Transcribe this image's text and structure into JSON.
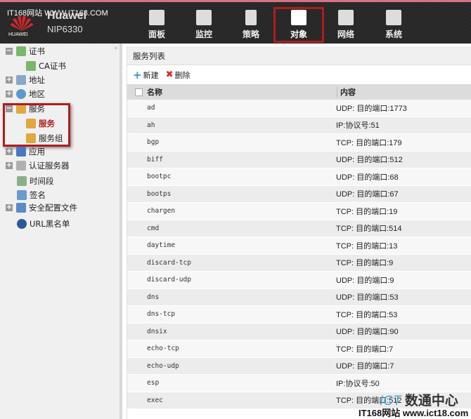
{
  "header": {
    "watermark": "IT168网站 WWW.IT168.COM",
    "logo_text": "HUAWEI",
    "brand": "Huawei",
    "model": "NIP6330",
    "nav": [
      {
        "label": "面板",
        "icon": "dashboard-icon"
      },
      {
        "label": "监控",
        "icon": "monitor-icon"
      },
      {
        "label": "策略",
        "icon": "policy-icon"
      },
      {
        "label": "对象",
        "icon": "object-icon",
        "selected": true
      },
      {
        "label": "网络",
        "icon": "network-icon"
      },
      {
        "label": "系统",
        "icon": "system-icon"
      }
    ],
    "accent": "#b01c1c"
  },
  "sidebar": {
    "items": [
      {
        "label": "证书",
        "expander": "−"
      },
      {
        "label": "CA证书"
      },
      {
        "label": "地址",
        "expander": "+"
      },
      {
        "label": "地区",
        "expander": "+"
      },
      {
        "label": "服务",
        "expander": "−"
      },
      {
        "label": "服务",
        "selected": true
      },
      {
        "label": "服务组"
      },
      {
        "label": "应用",
        "expander": "+"
      },
      {
        "label": "认证服务器",
        "expander": "+"
      },
      {
        "label": "时间段"
      },
      {
        "label": "签名"
      },
      {
        "label": "安全配置文件",
        "expander": "+"
      },
      {
        "label": "URL黑名单"
      }
    ]
  },
  "main": {
    "title": "服务列表",
    "toolbar": {
      "new": "新建",
      "delete": "删除"
    },
    "columns": [
      "名称",
      "内容"
    ],
    "rows": [
      [
        "ad",
        "UDP: 目的端口:1773"
      ],
      [
        "ah",
        "IP:协议号:51"
      ],
      [
        "bgp",
        "TCP: 目的端口:179"
      ],
      [
        "biff",
        "UDP: 目的端口:512"
      ],
      [
        "bootpc",
        "UDP: 目的端口:68"
      ],
      [
        "bootps",
        "UDP: 目的端口:67"
      ],
      [
        "chargen",
        "TCP: 目的端口:19"
      ],
      [
        "cmd",
        "TCP: 目的端口:514"
      ],
      [
        "daytime",
        "TCP: 目的端口:13"
      ],
      [
        "discard-tcp",
        "TCP: 目的端口:9"
      ],
      [
        "discard-udp",
        "UDP: 目的端口:9"
      ],
      [
        "dns",
        "UDP: 目的端口:53"
      ],
      [
        "dns-tcp",
        "TCP: 目的端口:53"
      ],
      [
        "dnsix",
        "UDP: 目的端口:90"
      ],
      [
        "echo-tcp",
        "TCP: 目的端口:7"
      ],
      [
        "echo-udp",
        "UDP: 目的端口:7"
      ],
      [
        "esp",
        "IP:协议号:50"
      ],
      [
        "exec",
        "TCP: 目的端口:512"
      ]
    ]
  },
  "watermarks": {
    "ict_prefix": "ICT",
    "ict_suffix": "数通中心",
    "site": "IT168网站 www.ict18.com"
  }
}
